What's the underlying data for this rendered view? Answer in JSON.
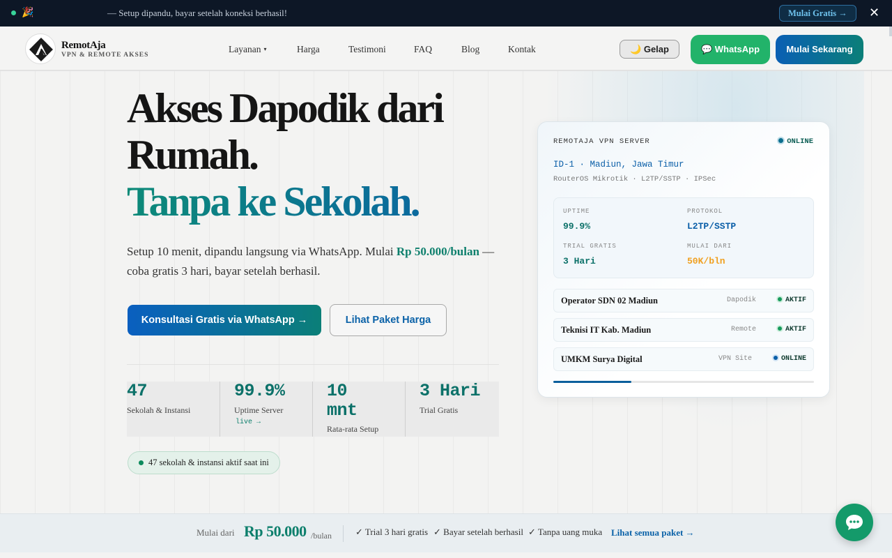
{
  "announcement": {
    "emoji": "🎉",
    "message": "— Setup dipandu, bayar setelah koneksi berhasil!",
    "cta_label": "Mulai Gratis →",
    "close_glyph": "✕"
  },
  "navbar": {
    "brand_name": "RemotAja",
    "brand_tagline": "VPN & REMOTE AKSES",
    "menu": [
      {
        "label": "Layanan",
        "has_dropdown": true
      },
      {
        "label": "Harga"
      },
      {
        "label": "Testimoni"
      },
      {
        "label": "FAQ"
      },
      {
        "label": "Blog"
      },
      {
        "label": "Kontak"
      }
    ],
    "dropdown_caret": "▾",
    "theme_toggle_label": "🌙 Gelap",
    "whatsapp_label": "💬 WhatsApp",
    "start_label": "Mulai Sekarang"
  },
  "hero": {
    "title_line1": "Akses Dapodik dari",
    "title_line2": "Rumah.",
    "title_accent": "Tanpa ke Sekolah.",
    "subtitle_pre": "Setup 10 menit, dipandu langsung via WhatsApp. Mulai ",
    "subtitle_price": "Rp 50.000/bulan",
    "subtitle_post": " — coba gratis 3 hari, bayar setelah berhasil.",
    "cta_primary": "Konsultasi Gratis via WhatsApp →",
    "cta_secondary": "Lihat Paket Harga",
    "stats": [
      {
        "value": "47",
        "label": "Sekolah & Instansi"
      },
      {
        "value": "99.9%",
        "label": "Uptime Server",
        "extra": "live →"
      },
      {
        "value": "10 mnt",
        "label": "Rata-rata Setup"
      },
      {
        "value": "3 Hari",
        "label": "Trial Gratis"
      }
    ],
    "active_pill": "47 sekolah & instansi aktif saat ini"
  },
  "server_card": {
    "title": "REMOTAJA VPN SERVER",
    "status": "ONLINE",
    "location": "ID-1 · Madiun, Jawa Timur",
    "spec": "RouterOS Mikrotik · L2TP/SSTP · IPSec",
    "metrics": [
      {
        "key": "UPTIME",
        "value": "99.9%"
      },
      {
        "key": "PROTOKOL",
        "value": "L2TP/SSTP"
      },
      {
        "key": "TRIAL GRATIS",
        "value": "3 Hari"
      },
      {
        "key": "MULAI DARI",
        "value": "50K/bln"
      }
    ],
    "clients": [
      {
        "name": "Operator SDN 02 Madiun",
        "type": "Dapodik",
        "status": "AKTIF"
      },
      {
        "name": "Teknisi IT Kab. Madiun",
        "type": "Remote",
        "status": "AKTIF"
      },
      {
        "name": "UMKM Surya Digital",
        "type": "VPN Site",
        "status": "ONLINE"
      }
    ],
    "progress_fraction": 0.3
  },
  "bottom_bar": {
    "from_label": "Mulai dari",
    "price": "Rp 50.000",
    "unit": "/bulan",
    "features": [
      "✓ Trial 3 hari gratis",
      "✓ Bayar setelah berhasil",
      "✓ Tanpa uang muka"
    ],
    "all_link": "Lihat semua paket →"
  },
  "colors": {
    "brand_teal": "#0d7f6c",
    "brand_blue": "#0b5fa8",
    "whatsapp_green": "#22b36a",
    "announcement_bg": "#0d1726"
  },
  "icons": {
    "logo": "remotaja-logo-icon",
    "chat": "chat-bubble-icon"
  }
}
